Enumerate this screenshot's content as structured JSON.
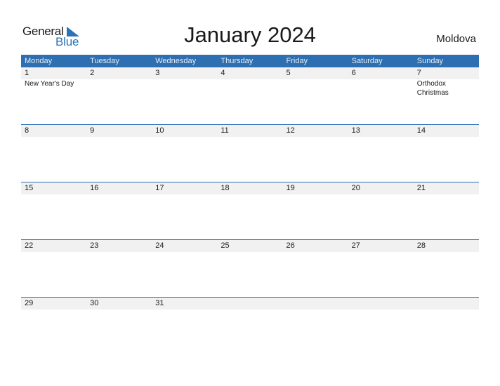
{
  "logo": {
    "text_general": "General",
    "text_blue": "Blue",
    "icon": "triangle-flag-icon",
    "brand_color": "#2a73b8"
  },
  "title": "January 2024",
  "country": "Moldova",
  "colors": {
    "header_bg": "#2d6fb0",
    "date_row_bg": "#f1f1f1"
  },
  "weekdays": [
    "Monday",
    "Tuesday",
    "Wednesday",
    "Thursday",
    "Friday",
    "Saturday",
    "Sunday"
  ],
  "weeks": [
    {
      "days": [
        "1",
        "2",
        "3",
        "4",
        "5",
        "6",
        "7"
      ],
      "events": [
        "New Year's Day",
        "",
        "",
        "",
        "",
        "",
        "Orthodox Christmas"
      ]
    },
    {
      "days": [
        "8",
        "9",
        "10",
        "11",
        "12",
        "13",
        "14"
      ],
      "events": [
        "",
        "",
        "",
        "",
        "",
        "",
        ""
      ]
    },
    {
      "days": [
        "15",
        "16",
        "17",
        "18",
        "19",
        "20",
        "21"
      ],
      "events": [
        "",
        "",
        "",
        "",
        "",
        "",
        ""
      ]
    },
    {
      "days": [
        "22",
        "23",
        "24",
        "25",
        "26",
        "27",
        "28"
      ],
      "events": [
        "",
        "",
        "",
        "",
        "",
        "",
        ""
      ]
    },
    {
      "days": [
        "29",
        "30",
        "31",
        "",
        "",
        "",
        ""
      ],
      "events": [
        "",
        "",
        "",
        "",
        "",
        "",
        ""
      ]
    }
  ]
}
